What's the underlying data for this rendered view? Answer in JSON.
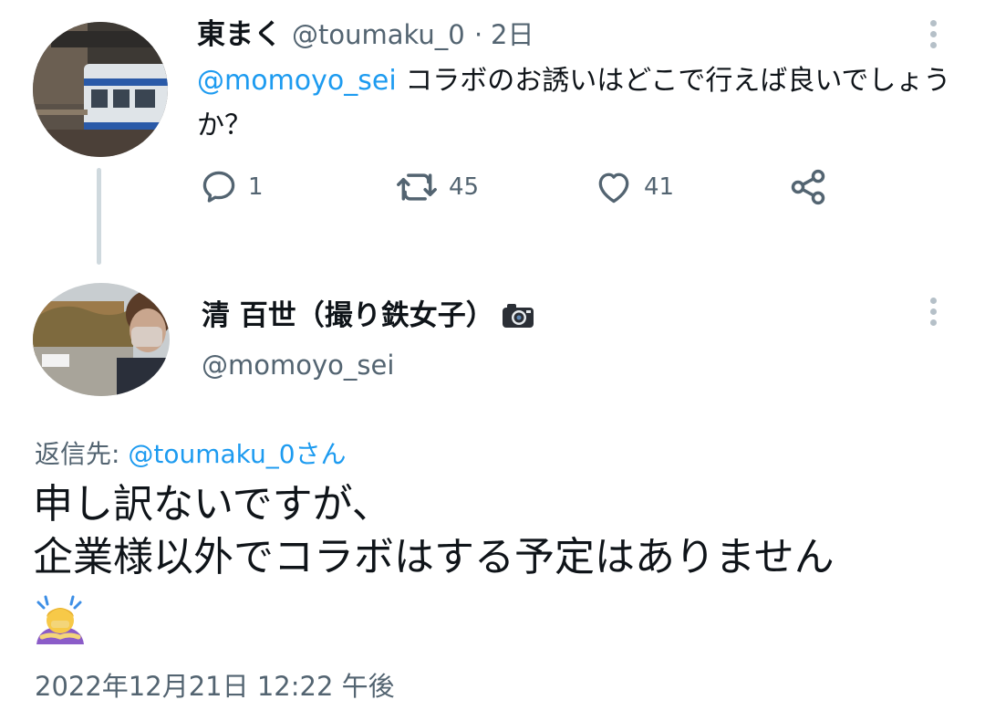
{
  "tweet_parent": {
    "display_name": "東まく",
    "handle": "@toumaku_0",
    "separator": "·",
    "time_ago": "2日",
    "mention": "@momoyo_sei",
    "text": " コラボのお誘いはどこで行えば良いでしょうか？",
    "actions": {
      "reply_count": "1",
      "retweet_count": "45",
      "like_count": "41"
    },
    "icons": {
      "reply": "reply-icon",
      "retweet": "retweet-icon",
      "like": "heart-icon",
      "share": "share-icon",
      "more": "more-vertical-icon"
    }
  },
  "tweet_main": {
    "display_name": "清 百世（撮り鉄女子）",
    "name_emoji": "camera-icon",
    "handle": "@momoyo_sei",
    "reply_label": "返信先: ",
    "reply_target": "@toumaku_0さん",
    "text_lines": [
      "申し訳ないですが、",
      "企業様以外でコラボはする予定はありません"
    ],
    "trailing_emoji": "person-bowing-icon",
    "timestamp": "2022年12月21日 12:22 午後"
  },
  "colors": {
    "text_primary": "#0f1419",
    "text_secondary": "#536471",
    "mention": "#1d9bf0",
    "thread_line": "#cfd9de"
  }
}
